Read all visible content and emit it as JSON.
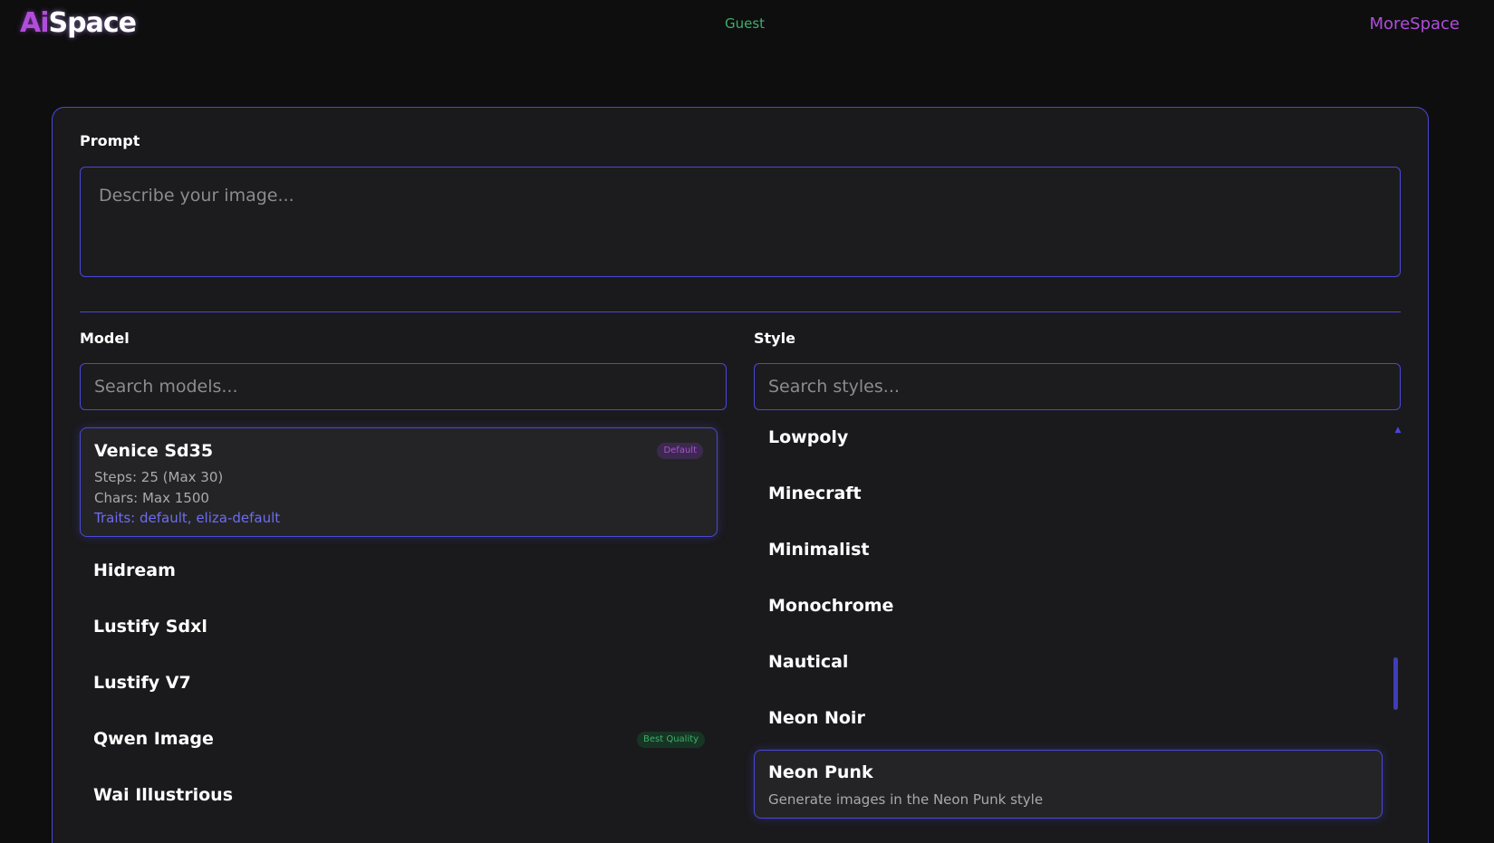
{
  "header": {
    "logo_ai": "Ai",
    "logo_space": "Space",
    "user": "Guest",
    "more_link": "MoreSpace"
  },
  "prompt": {
    "label": "Prompt",
    "placeholder": "Describe your image..."
  },
  "model": {
    "label": "Model",
    "search_placeholder": "Search models...",
    "selected": {
      "name": "Venice Sd35",
      "badge": "Default",
      "steps": "Steps: 25 (Max 30)",
      "chars": "Chars: Max 1500",
      "traits": "Traits: default, eliza-default"
    },
    "items": [
      {
        "name": "Hidream",
        "badge": ""
      },
      {
        "name": "Lustify Sdxl",
        "badge": ""
      },
      {
        "name": "Lustify V7",
        "badge": ""
      },
      {
        "name": "Qwen Image",
        "badge": "Best Quality"
      },
      {
        "name": "Wai Illustrious",
        "badge": ""
      }
    ]
  },
  "style": {
    "label": "Style",
    "search_placeholder": "Search styles...",
    "items": [
      "Lowpoly",
      "Minecraft",
      "Minimalist",
      "Monochrome",
      "Nautical",
      "Neon Noir"
    ],
    "selected": {
      "name": "Neon Punk",
      "description": "Generate images in the Neon Punk style"
    }
  },
  "colors": {
    "accent": "#4a47d8",
    "brand_purple": "#b04ddb",
    "green": "#3fae6a",
    "background": "#0e0e0f",
    "card": "#1a1a1c"
  }
}
